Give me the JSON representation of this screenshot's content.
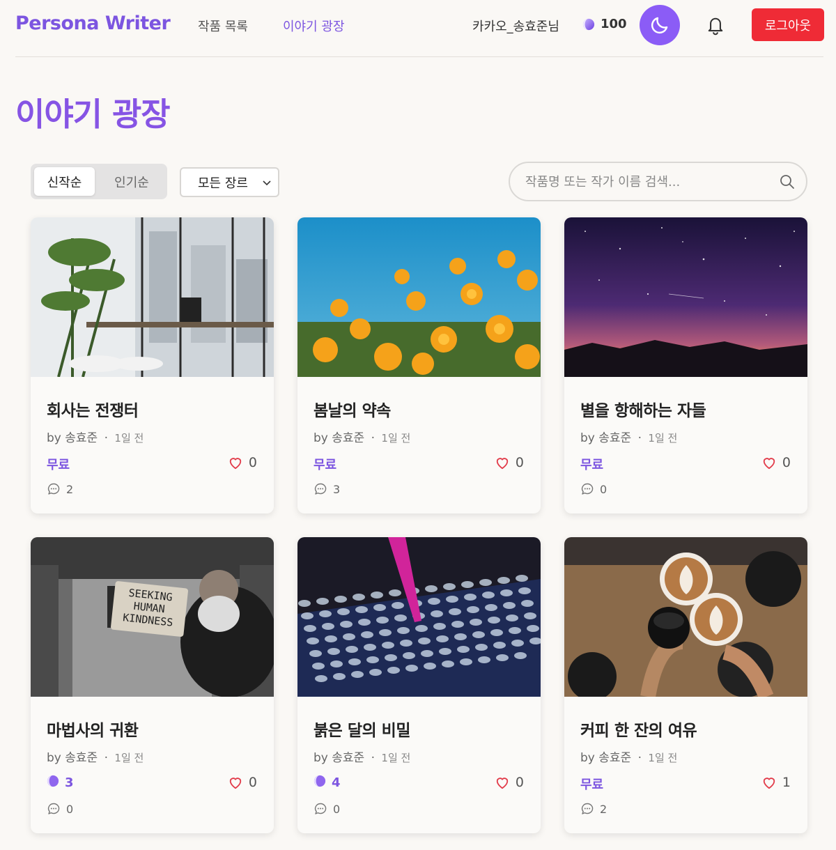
{
  "header": {
    "logo": "Persona Writer",
    "nav": [
      {
        "label": "작품 목록"
      },
      {
        "label": "이야기 광장"
      }
    ],
    "user_name": "카카오_송효준님",
    "credits": "100",
    "logout_label": "로그아웃"
  },
  "page": {
    "title": "이야기 광장"
  },
  "controls": {
    "sort_options": [
      {
        "label": "신작순",
        "active": true
      },
      {
        "label": "인기순",
        "active": false
      }
    ],
    "genre_selected": "모든 장르",
    "search_placeholder": "작품명 또는 작가 이름 검색..."
  },
  "cards": [
    {
      "title": "회사는 전쟁터",
      "author": "by 송효준",
      "sep": "·",
      "time": "1일 전",
      "price": "무료",
      "likes": "0",
      "comments": "2",
      "image": "office"
    },
    {
      "title": "봄날의 약속",
      "author": "by 송효준",
      "sep": "·",
      "time": "1일 전",
      "price": "무료",
      "likes": "0",
      "comments": "3",
      "image": "flowers"
    },
    {
      "title": "별을 항해하는 자들",
      "author": "by 송효준",
      "sep": "·",
      "time": "1일 전",
      "price": "무료",
      "likes": "0",
      "comments": "0",
      "image": "night-sky"
    },
    {
      "title": "마법사의 귀환",
      "author": "by 송효준",
      "sep": "·",
      "time": "1일 전",
      "price": "3",
      "likes": "0",
      "comments": "0",
      "image": "subway-man"
    },
    {
      "title": "붉은 달의 비밀",
      "author": "by 송효준",
      "sep": "·",
      "time": "1일 전",
      "price": "4",
      "likes": "0",
      "comments": "0",
      "image": "test-tubes"
    },
    {
      "title": "커피 한 잔의 여유",
      "author": "by 송효준",
      "sep": "·",
      "time": "1일 전",
      "price": "무료",
      "likes": "1",
      "comments": "2",
      "image": "coffee"
    }
  ],
  "colors": {
    "brand": "#7c55e0",
    "logout": "#ef2b36",
    "moon_button": "#8b5cf6",
    "background": "#faf8f5"
  }
}
